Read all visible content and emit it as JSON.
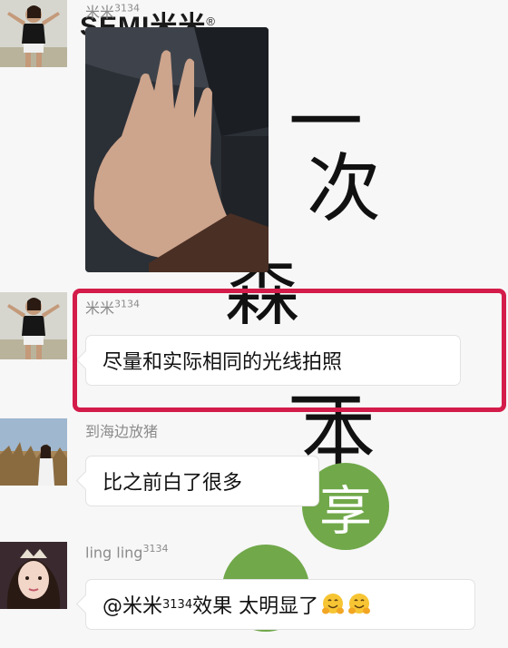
{
  "watermark": {
    "brand": "SEMI米米",
    "brand_mark": "®",
    "characters": [
      "一",
      "次",
      "森",
      "一",
      "本"
    ],
    "share_char": "享"
  },
  "messages": [
    {
      "sender": "米米",
      "sender_sup": "3134",
      "type": "image",
      "image_icon": "hand-photo"
    },
    {
      "sender": "米米",
      "sender_sup": "3134",
      "type": "text",
      "text": "尽量和实际相同的光线拍照",
      "highlighted": true
    },
    {
      "sender": "到海边放猪",
      "sender_sup": "",
      "type": "text",
      "text": "比之前白了很多"
    },
    {
      "sender": "ling ling",
      "sender_sup": "3134",
      "type": "text",
      "text_prefix": "@米米",
      "text_sup": "3134",
      "text_suffix": "效果 太明显了",
      "emojis": [
        "hugging-face-icon",
        "hugging-face-icon"
      ]
    }
  ],
  "colors": {
    "highlight": "#d31c4a",
    "share_green": "#71a84a"
  }
}
